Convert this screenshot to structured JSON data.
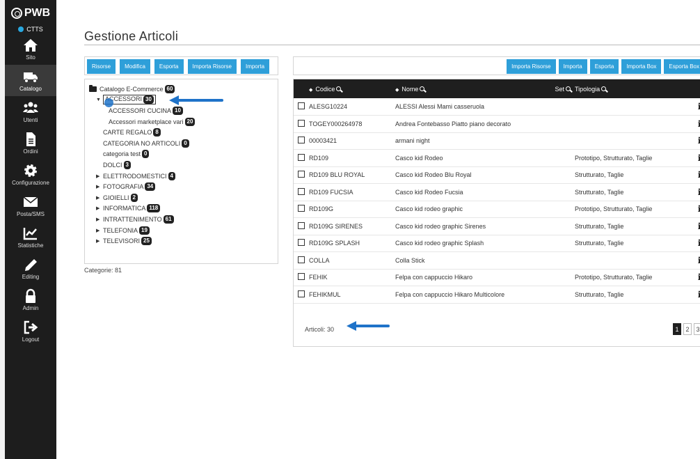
{
  "app": {
    "brand": "PWB",
    "status_label": "CTTS",
    "status_color": "#29a8e0"
  },
  "nav": [
    {
      "label": "Sito",
      "icon": "home-icon"
    },
    {
      "label": "Catalogo",
      "icon": "truck-icon",
      "active": true
    },
    {
      "label": "Utenti",
      "icon": "users-icon"
    },
    {
      "label": "Ordini",
      "icon": "document-icon"
    },
    {
      "label": "Configurazione",
      "icon": "gear-icon"
    },
    {
      "label": "Posta/SMS",
      "icon": "envelope-icon"
    },
    {
      "label": "Statistiche",
      "icon": "chart-icon"
    },
    {
      "label": "Editing",
      "icon": "pencil-icon"
    },
    {
      "label": "Admin",
      "icon": "lock-icon"
    },
    {
      "label": "Logout",
      "icon": "logout-icon"
    }
  ],
  "page": {
    "title": "Gestione Articoli"
  },
  "left_toolbar": [
    "Risorse",
    "Modifica",
    "Esporta",
    "Importa Risorse",
    "Importa"
  ],
  "tree": {
    "root": {
      "label": "Catalogo E-Commerce",
      "count": "60"
    },
    "items": [
      {
        "label": "ACCESSORI",
        "count": "30",
        "caret": "▼",
        "indent": 1,
        "selected": true
      },
      {
        "label": "ACCESSORI CUCINA",
        "count": "10",
        "caret": "",
        "indent": 2
      },
      {
        "label": "Accessori marketplace vari",
        "count": "20",
        "caret": "",
        "indent": 2
      },
      {
        "label": "CARTE REGALO",
        "count": "8",
        "caret": "",
        "indent": 1
      },
      {
        "label": "CATEGORIA NO ARTICOLI",
        "count": "0",
        "caret": "",
        "indent": 1
      },
      {
        "label": "categoria test",
        "count": "0",
        "caret": "",
        "indent": 1
      },
      {
        "label": "DOLCI",
        "count": "3",
        "caret": "",
        "indent": 1
      },
      {
        "label": "ELETTRODOMESTICI",
        "count": "4",
        "caret": "▶",
        "indent": 1
      },
      {
        "label": "FOTOGRAFIA",
        "count": "34",
        "caret": "▶",
        "indent": 1
      },
      {
        "label": "GIOIELLI",
        "count": "2",
        "caret": "▶",
        "indent": 1
      },
      {
        "label": "INFORMATICA",
        "count": "118",
        "caret": "▶",
        "indent": 1
      },
      {
        "label": "INTRATTENIMENTO",
        "count": "61",
        "caret": "▶",
        "indent": 1
      },
      {
        "label": "TELEFONIA",
        "count": "19",
        "caret": "▶",
        "indent": 1
      },
      {
        "label": "TELEVISORI",
        "count": "25",
        "caret": "▶",
        "indent": 1
      }
    ],
    "total_label": "Categorie: 81"
  },
  "right_toolbar": [
    "Importa Risorse",
    "Importa",
    "Esporta",
    "Importa Box",
    "Esporta Box"
  ],
  "table": {
    "headers": {
      "code": "Codice",
      "name": "Nome",
      "set": "Set",
      "type": "Tipologia"
    },
    "rows": [
      {
        "code": "ALESG10224",
        "name": "ALESSI Alessi Mami casseruola",
        "type": ""
      },
      {
        "code": "TOGEY000264978",
        "name": "Andrea Fontebasso Piatto piano decorato",
        "type": ""
      },
      {
        "code": "00003421",
        "name": "armani night",
        "type": ""
      },
      {
        "code": "RD109",
        "name": "Casco kid Rodeo",
        "type": "Prototipo, Strutturato, Taglie"
      },
      {
        "code": "RD109 BLU ROYAL",
        "name": "Casco kid Rodeo Blu Royal",
        "type": "Strutturato, Taglie"
      },
      {
        "code": "RD109 FUCSIA",
        "name": "Casco kid Rodeo Fucsia",
        "type": "Strutturato, Taglie"
      },
      {
        "code": "RD109G",
        "name": "Casco kid rodeo graphic",
        "type": "Prototipo, Strutturato, Taglie"
      },
      {
        "code": "RD109G SIRENES",
        "name": "Casco kid rodeo graphic Sirenes",
        "type": "Strutturato, Taglie"
      },
      {
        "code": "RD109G SPLASH",
        "name": "Casco kid rodeo graphic Splash",
        "type": "Strutturato, Taglie"
      },
      {
        "code": "COLLA",
        "name": "Colla Stick",
        "type": ""
      },
      {
        "code": "FEHIK",
        "name": "Felpa con cappuccio Hikaro",
        "type": "Prototipo, Strutturato, Taglie"
      },
      {
        "code": "FEHIKMUL",
        "name": "Felpa con cappuccio Hikaro Multicolore",
        "type": "Strutturato, Taglie"
      }
    ],
    "info_glyph": "i",
    "footer": "Articoli: 30",
    "pages": [
      "1",
      "2",
      "3"
    ],
    "current_page": "1"
  },
  "colors": {
    "accent": "#2e9fd9",
    "sidebar": "#1d1d1d",
    "table_header": "#1f1f1f",
    "arrow": "#1f73c9"
  }
}
